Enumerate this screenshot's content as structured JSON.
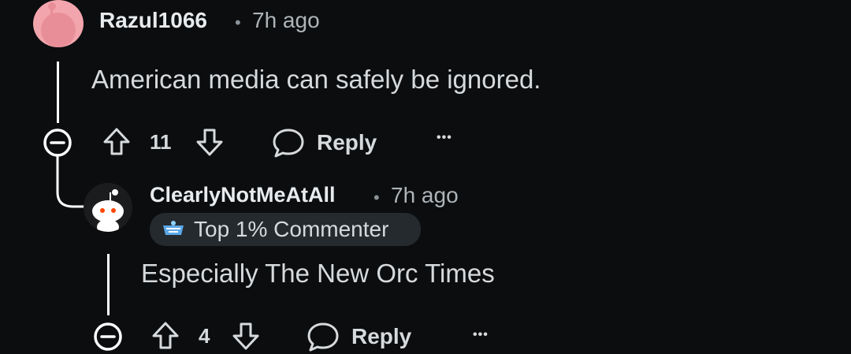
{
  "comment1": {
    "author": "Razul1066",
    "separator": "•",
    "time": "7h ago",
    "text": "American media can safely be ignored.",
    "upvotes": "11",
    "reply_label": "Reply",
    "more_label": "•••"
  },
  "comment2": {
    "author": "ClearlyNotMeAtAll",
    "separator": "•",
    "time": "7h ago",
    "badge": "Top 1% Commenter",
    "text": "Especially The New Orc Times",
    "upvotes": "4",
    "reply_label": "Reply",
    "more_label": "•••"
  },
  "colors": {
    "background": "#0b0d0f",
    "avatar1": "#f3a5ad",
    "avatar2": "#1a1c1e",
    "badge_bg": "#252a2f"
  },
  "icons": [
    "collapse-icon",
    "upvote-icon",
    "downvote-icon",
    "comment-bubble-icon",
    "more-options-icon",
    "avatar-icon",
    "top-commenter-badge-icon"
  ]
}
